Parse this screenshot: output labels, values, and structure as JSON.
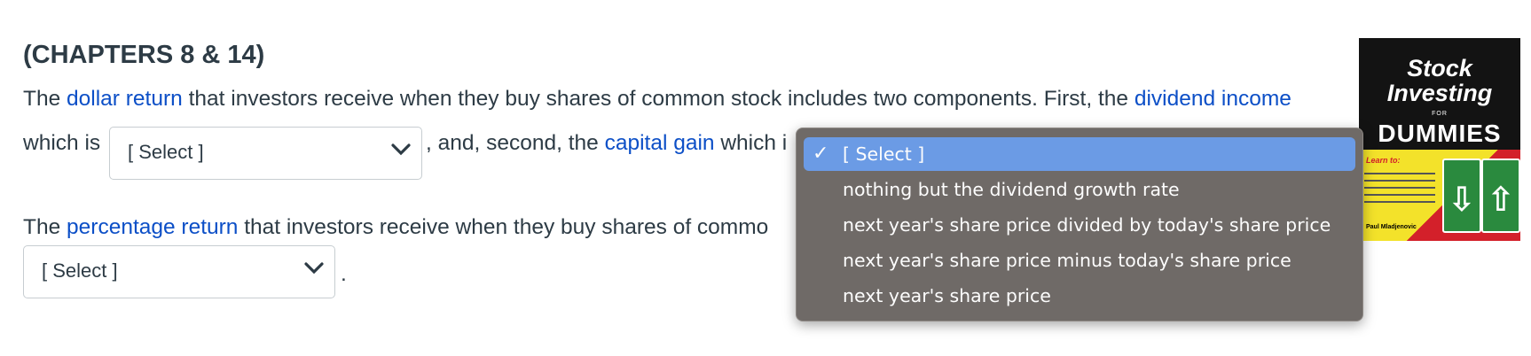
{
  "heading": "(CHAPTERS 8 & 14)",
  "q1": {
    "p1": "The ",
    "link1": "dollar return",
    "p2": " that investors receive when they buy shares of common stock includes two components. First, the ",
    "link2": "dividend income",
    "p3": "which is",
    "select1_value": "[ Select ]",
    "p4": ", and, second, the ",
    "link3": "capital gain",
    "p5": " which i"
  },
  "q2": {
    "p1": "The ",
    "link1": "percentage return",
    "p2": " that investors receive when they buy shares of commo",
    "select_value": "[ Select ]",
    "period": "."
  },
  "dropdown": {
    "check": "✓",
    "options": [
      {
        "label": "[ Select ]",
        "selected": true
      },
      {
        "label": "nothing but the dividend growth rate",
        "selected": false
      },
      {
        "label": "next year's share price divided by today's share price",
        "selected": false
      },
      {
        "label": "next year's share price minus today's share price",
        "selected": false
      },
      {
        "label": "next year's share price",
        "selected": false
      }
    ]
  },
  "book": {
    "title_line1": "Stock",
    "title_line2": "Investing",
    "for": "FOR",
    "brand": "DUMMIES",
    "learn": "Learn to:",
    "author": "Paul Mladjenovic",
    "sign_left": "⇩",
    "sign_right": "⇧"
  },
  "colors": {
    "link": "#0c4fc7",
    "dropdown_bg": "#6f6a67",
    "selected_bg": "#6b9be5",
    "text": "#2d3b45"
  }
}
